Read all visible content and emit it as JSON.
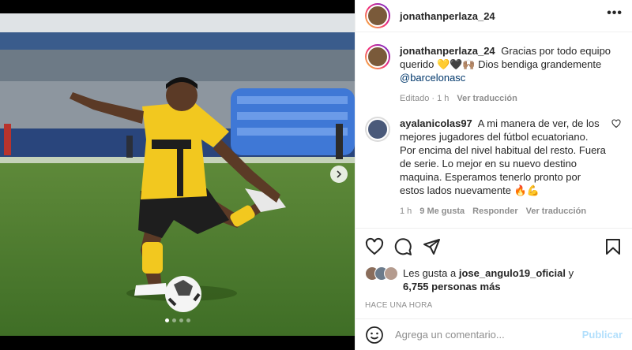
{
  "post": {
    "username": "jonathanperlaza_24",
    "more_label": "•••",
    "media_dots": 4,
    "active_dot": 0
  },
  "comments": [
    {
      "username": "jonathanperlaza_24",
      "text": "Gracias por todo equipo querido 💛🖤🙌🏽 Dios bendiga grandemente",
      "mention": "@barcelonasc",
      "meta": {
        "edited": "Editado · 1 h",
        "translate": "Ver traducción"
      }
    },
    {
      "username": "ayalanicolas97",
      "text": "A mi manera de ver, de los mejores jugadores del fútbol ecuatoriano. Por encima del nivel habitual del resto. Fuera de serie. Lo mejor en su nuevo destino maquina. Esperamos tenerlo pronto por estos lados nuevamente 🔥💪",
      "meta": {
        "time": "1 h",
        "likes": "9 Me gusta",
        "reply": "Responder",
        "translate": "Ver traducción"
      }
    }
  ],
  "likes": {
    "prefix": "Les gusta a",
    "user": "jose_angulo19_oficial",
    "conj": "y",
    "others": "6,755 personas más"
  },
  "timestamp": "HACE UNA HORA",
  "add_comment": {
    "placeholder": "Agrega un comentario...",
    "publish_label": "Publicar"
  },
  "colors": {
    "link": "#00376b",
    "muted": "#8e8e8e",
    "publish_disabled": "#b2dffc",
    "jersey": "#f2c81f"
  }
}
